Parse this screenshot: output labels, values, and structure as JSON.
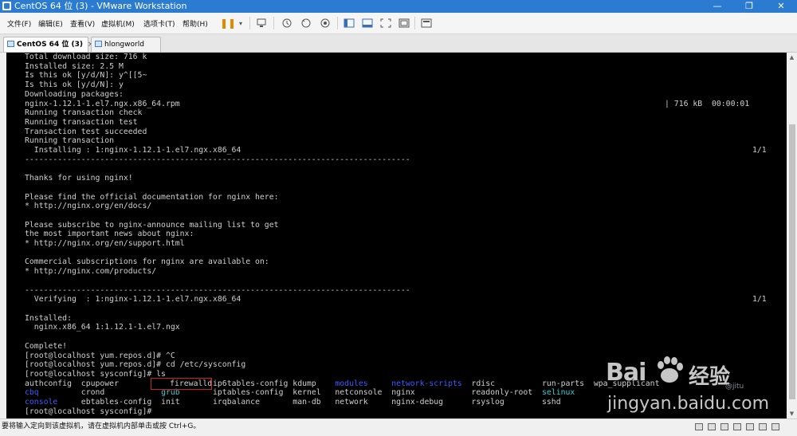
{
  "window": {
    "title": "CentOS 64 位 (3) - VMware Workstation",
    "minimize": "—",
    "maximize": "❐",
    "close": "✕"
  },
  "menu": {
    "items": [
      {
        "label": "文件(F)"
      },
      {
        "label": "编辑(E)"
      },
      {
        "label": "查看(V)"
      },
      {
        "label": "虚拟机(M)"
      },
      {
        "label": "选项卡(T)"
      },
      {
        "label": "帮助(H)"
      }
    ]
  },
  "toolbar": {
    "icons": [
      "pause-icon",
      "send-ctrl-alt-del-icon",
      "snapshot-icon",
      "revert-snapshot-icon",
      "snapshot-manager-icon",
      "sidebar-icon",
      "console-view-icon",
      "fullscreen-icon",
      "unity-icon",
      "thumbnail-icon"
    ]
  },
  "tabs": [
    {
      "label": "CentOS 64 位 (3)",
      "active": true,
      "close": "×"
    },
    {
      "label": "hlongworld",
      "active": false
    }
  ],
  "console": {
    "lines": [
      "Total download size: 716 k",
      "Installed size: 2.5 M",
      "Is this ok [y/d/N]: y^[[5~",
      "Is this ok [y/d/N]: y",
      "Downloading packages:",
      "nginx-1.12.1-1.el7.ngx.x86_64.rpm",
      "Running transaction check",
      "Running transaction test",
      "Transaction test succeeded",
      "Running transaction",
      "  Installing : 1:nginx-1.12.1-1.el7.ngx.x86_64",
      "----------------------------------------------------------------------------------",
      "",
      "Thanks for using nginx!",
      "",
      "Please find the official documentation for nginx here:",
      "* http://nginx.org/en/docs/",
      "",
      "Please subscribe to nginx-announce mailing list to get",
      "the most important news about nginx:",
      "* http://nginx.org/en/support.html",
      "",
      "Commercial subscriptions for nginx are available on:",
      "* http://nginx.com/products/",
      "",
      "----------------------------------------------------------------------------------",
      "  Verifying  : 1:nginx-1.12.1-1.el7.ngx.x86_64",
      "",
      "Installed:",
      "  nginx.x86_64 1:1.12.1-1.el7.ngx",
      "",
      "Complete!",
      "[root@localhost yum.repos.d]# ^C",
      "[root@localhost yum.repos.d]# cd /etc/sysconfig",
      "[root@localhost sysconfig]# ls"
    ],
    "download_stats": "| 716 kB  00:00:01",
    "installing_count": "1/1",
    "verifying_count": "1/1",
    "ls_output": [
      [
        {
          "text": "authconfig",
          "color": "gray"
        },
        {
          "text": "cpupower",
          "color": "gray"
        },
        {
          "text": "firewalld",
          "color": "gray"
        },
        {
          "text": "ip6tables-config",
          "color": "gray"
        },
        {
          "text": "kdump",
          "color": "gray"
        },
        {
          "text": "modules",
          "color": "blue"
        },
        {
          "text": "network-scripts",
          "color": "blue"
        },
        {
          "text": "rdisc",
          "color": "gray"
        },
        {
          "text": "run-parts",
          "color": "gray"
        },
        {
          "text": "wpa_supplicant",
          "color": "gray"
        }
      ],
      [
        {
          "text": "cbq",
          "color": "blue"
        },
        {
          "text": "crond",
          "color": "gray"
        },
        {
          "text": "grub",
          "color": "cyan"
        },
        {
          "text": "iptables-config",
          "color": "gray"
        },
        {
          "text": "kernel",
          "color": "gray"
        },
        {
          "text": "netconsole",
          "color": "gray"
        },
        {
          "text": "nginx",
          "color": "gray"
        },
        {
          "text": "readonly-root",
          "color": "gray"
        },
        {
          "text": "selinux",
          "color": "cyan"
        }
      ],
      [
        {
          "text": "console",
          "color": "blue"
        },
        {
          "text": "ebtables-config",
          "color": "gray"
        },
        {
          "text": "init",
          "color": "gray"
        },
        {
          "text": "irqbalance",
          "color": "gray"
        },
        {
          "text": "man-db",
          "color": "gray"
        },
        {
          "text": "network",
          "color": "gray"
        },
        {
          "text": "nginx-debug",
          "color": "gray"
        },
        {
          "text": "rsyslog",
          "color": "gray"
        },
        {
          "text": "sshd",
          "color": "gray"
        }
      ]
    ],
    "final_prompt": "[root@localhost sysconfig]# ",
    "highlighted_entry": "firewalld",
    "colors": {
      "gray": "#cfcfcf",
      "blue": "#3c5cff",
      "cyan": "#33d0d8",
      "highlight": "#d02020"
    }
  },
  "statusbar": {
    "message": "要将输入定向到该虚拟机，请在虚拟机内部单击或按 Ctrl+G。"
  },
  "watermark": {
    "brand": "Bai",
    "brand_cn": "经验",
    "url": "jingyan.baidu.com",
    "sub": "@jitu"
  }
}
